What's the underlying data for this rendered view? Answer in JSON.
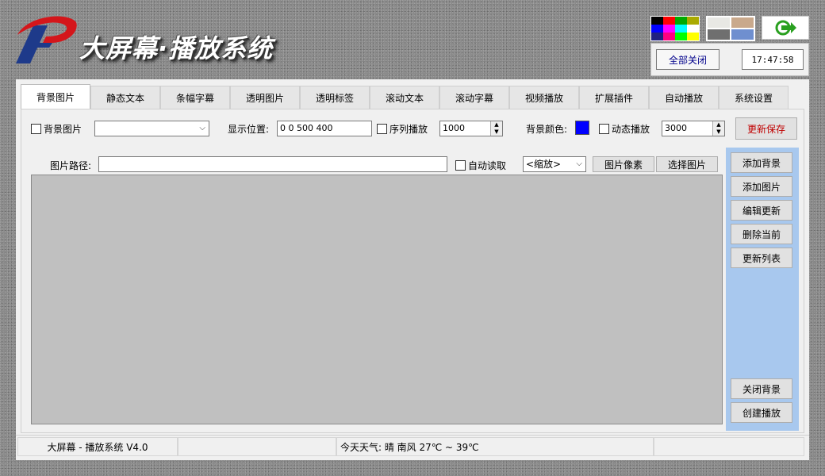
{
  "app": {
    "title": "大屏幕·播放系统"
  },
  "header": {
    "close_all_label": "全部关闭",
    "clock": "17:47:58",
    "swatch_colors": [
      "#000000",
      "#ff0000",
      "#00aa00",
      "#aaaa00",
      "#0000ff",
      "#ff00ff",
      "#00ffff",
      "#ffffff",
      "#202080",
      "#ff0080",
      "#00ff00",
      "#ffff00"
    ],
    "texture_colors": [
      "#e8e8e4",
      "#c9a98c",
      "#6f6f6f",
      "#6f8fcf"
    ]
  },
  "tabs": [
    "背景图片",
    "静态文本",
    "条幅字幕",
    "透明图片",
    "透明标签",
    "滚动文本",
    "滚动字幕",
    "视频播放",
    "扩展插件",
    "自动播放",
    "系统设置"
  ],
  "active_tab": "背景图片",
  "panel": {
    "bg_image_check_label": "背景图片",
    "bg_image_combo_value": "",
    "display_pos_label": "显示位置:",
    "display_pos_value": "0 0 500 400",
    "seq_play_label": "序列播放",
    "seq_interval_value": "1000",
    "bg_color_label": "背景颜色:",
    "bg_color": "#0000ff",
    "dynamic_play_label": "动态播放",
    "dynamic_interval_value": "3000",
    "save_label": "更新保存",
    "image_path_label": "图片路径:",
    "image_path_value": "",
    "auto_read_label": "自动读取",
    "scale_value": "<缩放>",
    "pixel_label": "图片像素",
    "choose_label": "选择图片"
  },
  "side_buttons": {
    "add_bg": "添加背景",
    "add_image": "添加图片",
    "edit_update": "编辑更新",
    "delete_current": "删除当前",
    "refresh_list": "更新列表",
    "close_bg": "关闭背景",
    "create_play": "创建播放"
  },
  "statusbar": {
    "version": "大屏幕 - 播放系统 V4.0",
    "weather": "今天天气: 晴 南风 27℃ ~ 39℃"
  }
}
